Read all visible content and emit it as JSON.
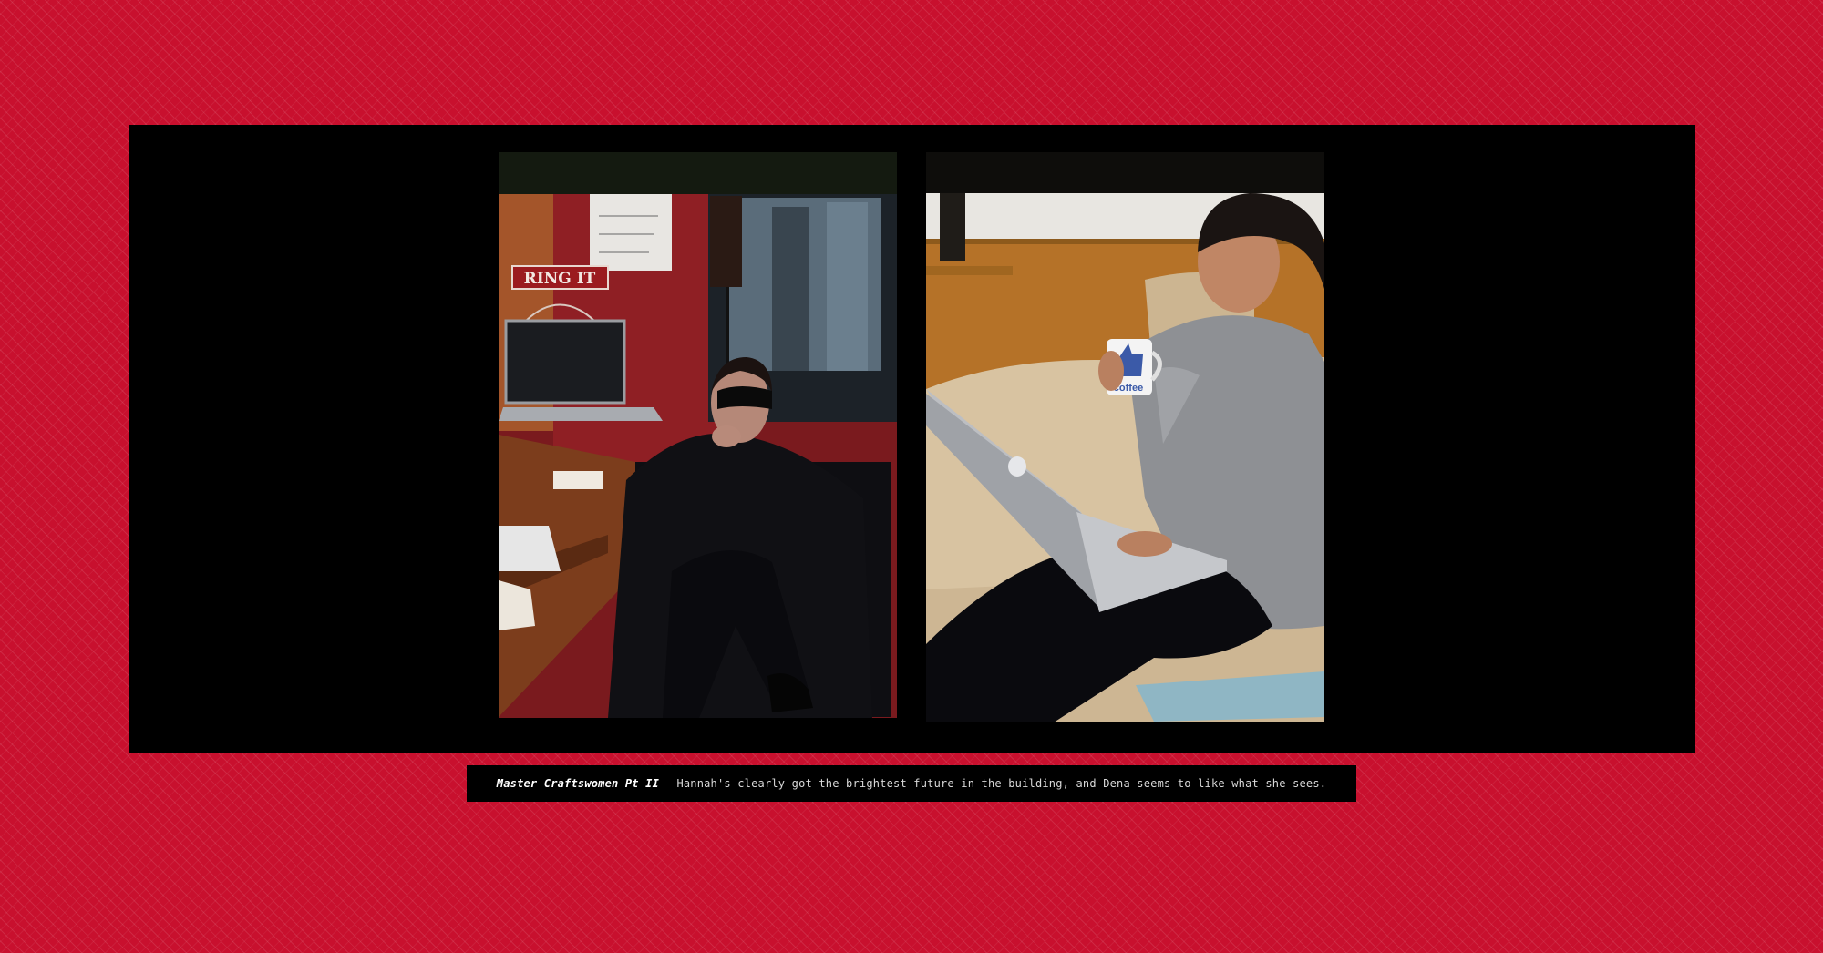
{
  "gallery": {
    "left_photo": {
      "sign_text": "RING IT"
    },
    "right_photo": {
      "mug_text": "coffee"
    },
    "caption": {
      "title": "Master Craftswomen Pt II",
      "separator": "-",
      "text": "Hannah's clearly got the brightest future in the building, and Dena seems to like what she sees."
    }
  },
  "colors": {
    "background": "#c8102e",
    "stage": "#000000"
  }
}
